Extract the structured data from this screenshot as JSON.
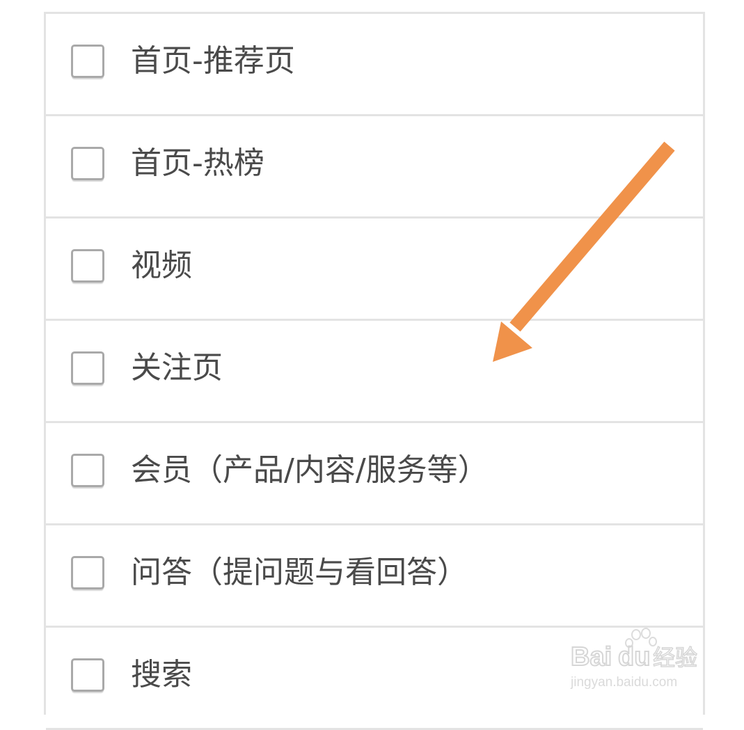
{
  "options": [
    {
      "label": "首页-推荐页",
      "checked": false
    },
    {
      "label": "首页-热榜",
      "checked": false
    },
    {
      "label": "视频",
      "checked": false
    },
    {
      "label": "关注页",
      "checked": false
    },
    {
      "label": "会员（产品/内容/服务等）",
      "checked": false
    },
    {
      "label": "问答（提问题与看回答）",
      "checked": false
    },
    {
      "label": "搜索",
      "checked": false
    }
  ],
  "annotation": {
    "arrow_color": "#f0924a"
  },
  "watermark": {
    "text": "Baidu经验",
    "url": "jingyan.baidu.com"
  },
  "colors": {
    "border": "#e3e3e3",
    "checkbox_border": "#a9a9a9",
    "label_text": "#4a4a4a"
  }
}
